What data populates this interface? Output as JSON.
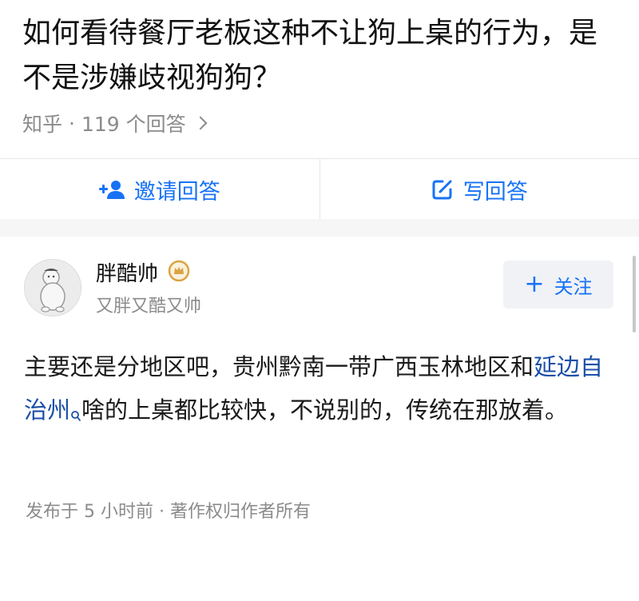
{
  "question": {
    "title": "如何看待餐厅老板这种不让狗上桌的行为，是不是涉嫌歧视狗狗？",
    "source": "知乎",
    "separator": "·",
    "answer_count": "119 个回答"
  },
  "actions": {
    "invite_label": "邀请回答",
    "write_label": "写回答"
  },
  "answer": {
    "author_name": "胖酷帅",
    "author_bio": "又胖又酷又帅",
    "follow_label": "关注",
    "body_before_link": "主要还是分地区吧，贵州黔南一带广西玉林地区和",
    "body_link": "延边自治州",
    "body_after_link": "啥的上桌都比较快，不说别的，传统在那放着。",
    "meta": "发布于 5 小时前 · 著作权归作者所有"
  },
  "colors": {
    "accent": "#1772f6",
    "link": "#1a4fa8",
    "muted": "#8b8b8b",
    "badge": "#d9a441"
  },
  "icons": [
    "chevron-right-icon",
    "invite-person-icon",
    "edit-icon",
    "badge-icon",
    "search-mark-icon",
    "plus-icon"
  ]
}
